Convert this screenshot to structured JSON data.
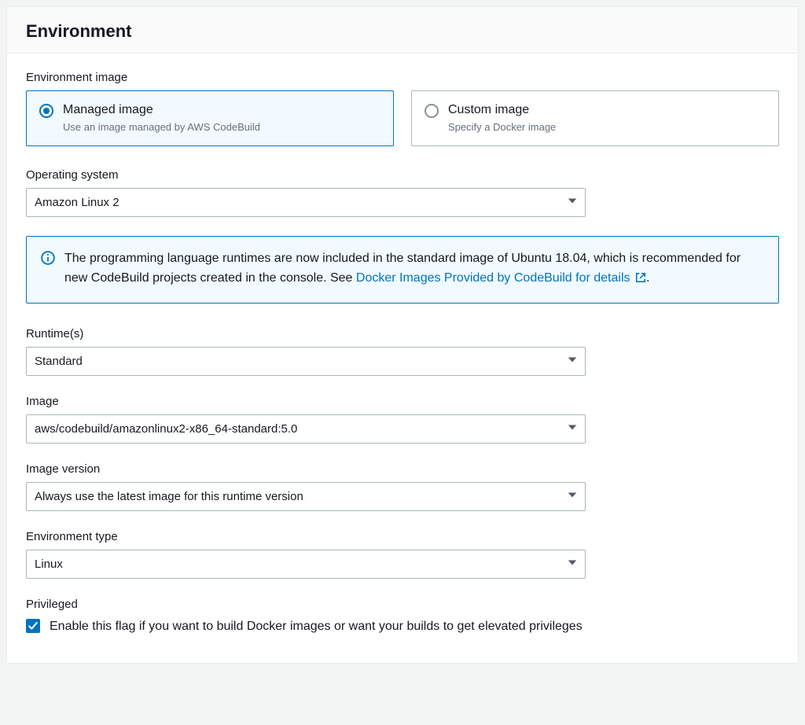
{
  "section_title": "Environment",
  "env_image": {
    "label": "Environment image",
    "options": [
      {
        "title": "Managed image",
        "desc": "Use an image managed by AWS CodeBuild",
        "selected": true
      },
      {
        "title": "Custom image",
        "desc": "Specify a Docker image",
        "selected": false
      }
    ]
  },
  "os": {
    "label": "Operating system",
    "value": "Amazon Linux 2"
  },
  "info_alert": {
    "text_before_link": "The programming language runtimes are now included in the standard image of Ubuntu 18.04, which is recommended for new CodeBuild projects created in the console. See ",
    "link_text": "Docker Images Provided by CodeBuild for details",
    "text_after_link": "."
  },
  "runtime": {
    "label": "Runtime(s)",
    "value": "Standard"
  },
  "image": {
    "label": "Image",
    "value": "aws/codebuild/amazonlinux2-x86_64-standard:5.0"
  },
  "image_version": {
    "label": "Image version",
    "value": "Always use the latest image for this runtime version"
  },
  "env_type": {
    "label": "Environment type",
    "value": "Linux"
  },
  "privileged": {
    "label": "Privileged",
    "desc": "Enable this flag if you want to build Docker images or want your builds to get elevated privileges",
    "checked": true
  }
}
